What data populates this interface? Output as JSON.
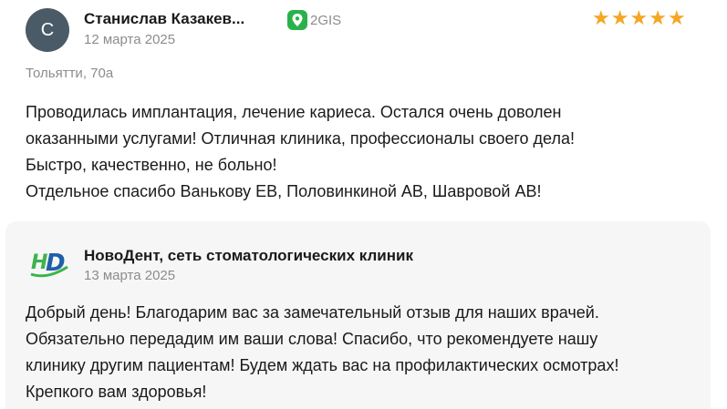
{
  "review": {
    "avatar_letter": "С",
    "author_name": "Станислав Казакев...",
    "date": "12 марта 2025",
    "source": "2GIS",
    "rating": 5,
    "location": "Тольятти, 70а",
    "text_lines": [
      "Проводилась имплантация, лечение кариеса. Остался очень доволен",
      "оказанными услугами! Отличная клиника, профессионалы своего дела!",
      "Быстро, качественно, не больно!",
      "Отдельное спасибо Ванькову ЕВ, Половинкиной АВ, Шавровой АВ!"
    ]
  },
  "reply": {
    "author_name": "НовоДент, сеть стоматологических клиник",
    "date": "13 марта 2025",
    "text_lines": [
      "Добрый день! Благодарим вас за замечательный отзыв для наших врачей.",
      "Обязательно передадим им ваши слова! Спасибо, что рекомендуете нашу",
      "клинику другим пациентам! Будем ждать вас на профилактических осмотрах!",
      "Крепкого вам здоровья!"
    ]
  },
  "colors": {
    "star": "#f5a623",
    "source_green": "#29b24a",
    "avatar_bg": "#4a5a66",
    "reply_bg": "#f6f6f7",
    "logo_green": "#3cb44a",
    "logo_blue": "#1f5fa8"
  },
  "icons": {
    "source_icon": "2gis-pin-icon",
    "star_icon": "star-icon",
    "reply_logo": "novodent-logo"
  }
}
